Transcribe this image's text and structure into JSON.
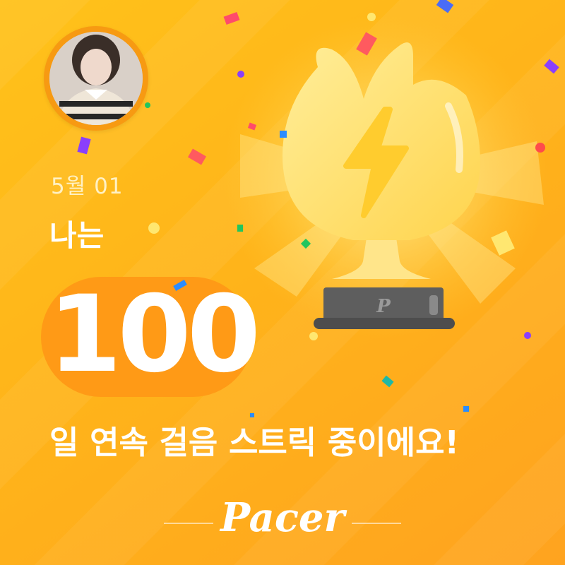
{
  "user": {
    "avatar_alt": "profile photo"
  },
  "card": {
    "date": "5월 01",
    "intro": "나는",
    "streak_days": "100",
    "message": "일 연속 걸음 스트릭 중이에요!",
    "brand": "Pacer",
    "trophy_letter": "P"
  },
  "colors": {
    "background": "#FFB41A",
    "badge": "#FF9A16",
    "trophy": "#FFE27A",
    "base": "#5A5A5A",
    "text": "#FFFFFF"
  },
  "icons": {
    "trophy": "trophy-icon",
    "bolt": "lightning-bolt-icon"
  }
}
